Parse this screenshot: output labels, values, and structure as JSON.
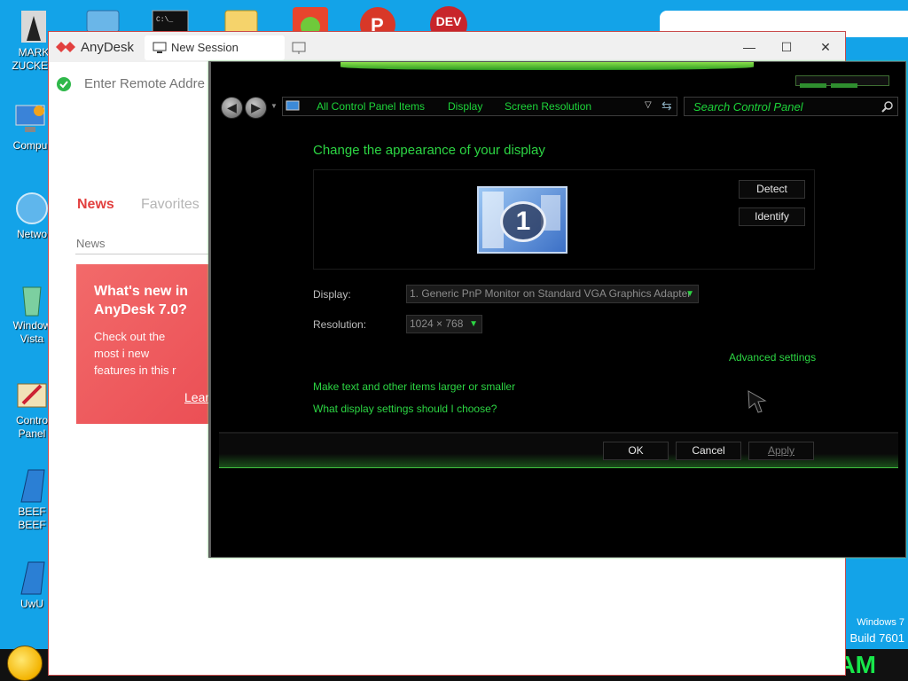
{
  "desktop": {
    "icons": [
      {
        "label": "MARK ZUCKER",
        "icon": "user-folder-icon"
      },
      {
        "label": "Compu",
        "icon": "computer-icon"
      },
      {
        "label": "Netwo",
        "icon": "network-icon"
      },
      {
        "label": "Window Vista",
        "icon": "recycle-bin-icon"
      },
      {
        "label": "Contro Panel",
        "icon": "control-panel-icon"
      },
      {
        "label": "BEEF BEEF",
        "icon": "shortcut-icon"
      },
      {
        "label": "UwU",
        "icon": "shortcut-icon"
      }
    ],
    "top_icon_dev": "DEV",
    "watermark_line1": "Windows 7",
    "watermark_line2": "Build 7601",
    "clock": "AM"
  },
  "anydesk": {
    "brand": "AnyDesk",
    "tab_label": "New Session",
    "minimize": "—",
    "maximize": "☐",
    "close": "✕",
    "address_placeholder": "Enter Remote Addre",
    "tabs": {
      "news": "News",
      "favorites": "Favorites"
    },
    "news_section": "News",
    "card": {
      "title": "What's new in AnyDesk 7.0?",
      "body": "Check out the most i new features in this r",
      "learn": "Lear"
    },
    "accent": "#e2403f"
  },
  "control_panel": {
    "breadcrumbs": [
      "All Control Panel Items",
      "Display",
      "Screen Resolution"
    ],
    "search_placeholder": "Search Control Panel",
    "heading": "Change the appearance of your display",
    "monitor_number": "1",
    "detect": "Detect",
    "identify": "Identify",
    "display_label": "Display:",
    "display_value": "1. Generic PnP Monitor on Standard VGA Graphics Adapter",
    "resolution_label": "Resolution:",
    "resolution_value": "1024 × 768",
    "advanced": "Advanced settings",
    "link_text_size": "Make text and other items larger or smaller",
    "link_help": "What display settings should I choose?",
    "ok": "OK",
    "cancel": "Cancel",
    "apply": "Apply",
    "accent": "#2cd543"
  }
}
